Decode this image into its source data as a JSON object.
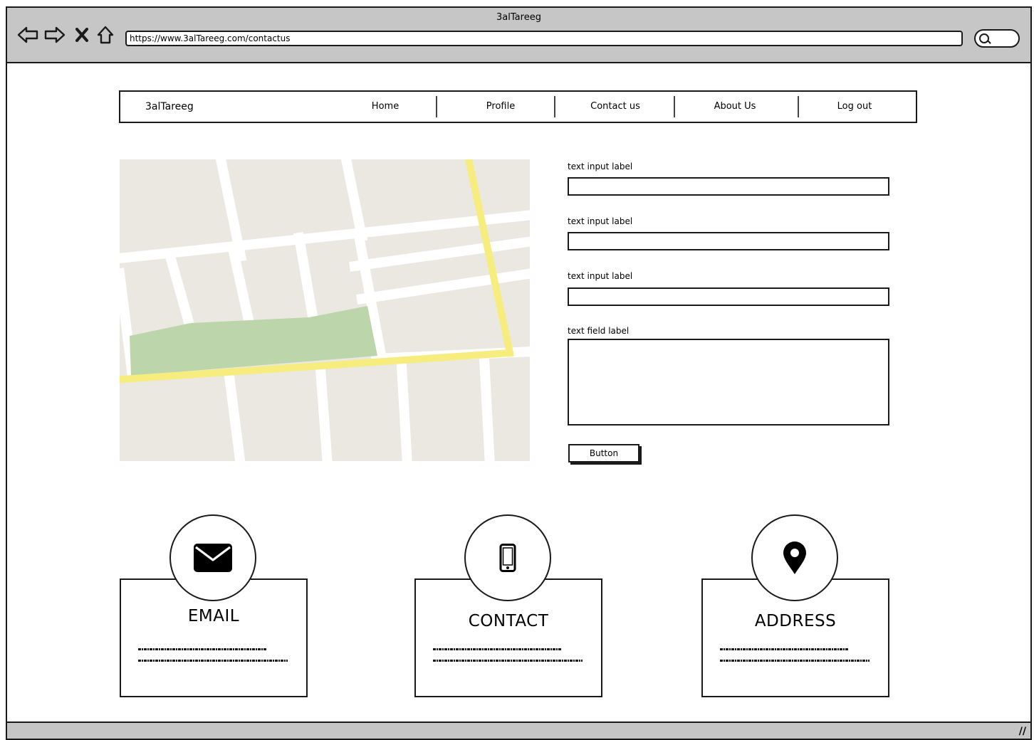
{
  "window": {
    "title": "3alTareeg",
    "url": "https://www.3alTareeg.com/contactus"
  },
  "nav": {
    "brand": "3alTareeg",
    "items": [
      {
        "label": "Home"
      },
      {
        "label": "Profile"
      },
      {
        "label": "Contact us"
      },
      {
        "label": "About Us"
      },
      {
        "label": "Log out"
      }
    ]
  },
  "form": {
    "fields": [
      {
        "label": "text input label",
        "value": ""
      },
      {
        "label": "text input label",
        "value": ""
      },
      {
        "label": "text input label",
        "value": ""
      }
    ],
    "textarea": {
      "label": "text field label",
      "value": ""
    },
    "button_label": "Button"
  },
  "cards": [
    {
      "title": "EMAIL",
      "icon": "envelope-icon"
    },
    {
      "title": "CONTACT",
      "icon": "mobile-phone-icon"
    },
    {
      "title": "ADDRESS",
      "icon": "map-pin-icon"
    }
  ],
  "colors": {
    "chrome": "#c6c6c6",
    "map_land": "#ebe8e2",
    "map_park": "#bcd5ab",
    "map_highway": "#f7ec7e",
    "map_road": "#ffffff"
  }
}
